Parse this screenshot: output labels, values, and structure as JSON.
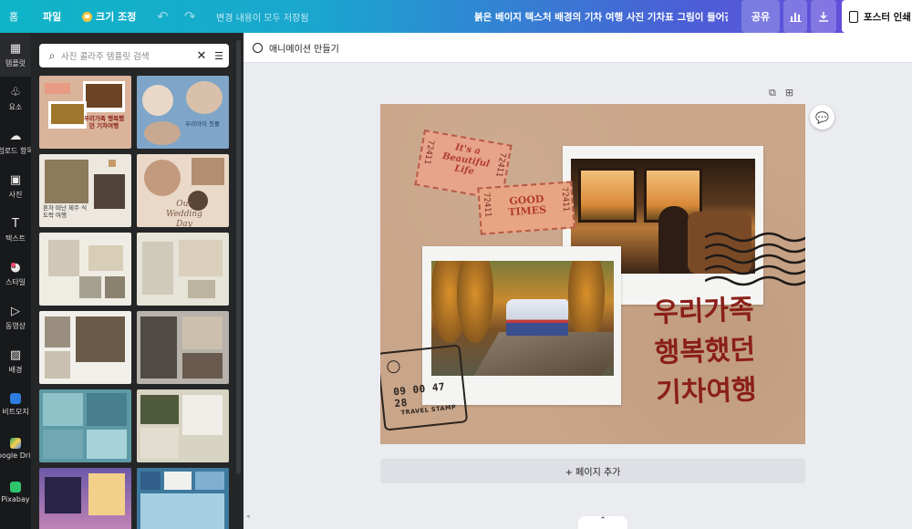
{
  "topbar": {
    "home": "홈",
    "file": "파일",
    "resize": "크기 조정",
    "saved": "변경 내용이 모두 저장됨",
    "title": "붉은 베이지 텍스처 배경의 기차 여행 사진 기차표 그림이 들어간 ...",
    "share": "공유",
    "print": "포스터 인쇄"
  },
  "rail": [
    {
      "label": "템플릿",
      "icon": "template-icon"
    },
    {
      "label": "요소",
      "icon": "elements-icon"
    },
    {
      "label": "업로드 항목",
      "icon": "upload-icon"
    },
    {
      "label": "사진",
      "icon": "photo-icon"
    },
    {
      "label": "텍스트",
      "icon": "text-icon"
    },
    {
      "label": "스타일",
      "icon": "palette-icon"
    },
    {
      "label": "동영상",
      "icon": "video-icon"
    },
    {
      "label": "배경",
      "icon": "background-icon"
    },
    {
      "label": "비트모지",
      "icon": "bitmoji-icon"
    },
    {
      "label": "Google Drive",
      "icon": "google-drive-icon"
    },
    {
      "label": "Pixabay",
      "icon": "pixabay-icon"
    }
  ],
  "search": {
    "placeholder": "사진 콜라주 템플릿 검색"
  },
  "thumbs": [
    {
      "text": "우리가족 행복했던 기차여행",
      "bg": "#d9b39a"
    },
    {
      "text": "우리아이 첫돌",
      "bg": "#7fa6c9"
    },
    {
      "text": "혼자 떠난 제주 식도락 여행",
      "bg": "#ece7df"
    },
    {
      "text": "Our Wedding Day",
      "bg": "#ead8c9"
    },
    {
      "text": "",
      "bg": "#efece4"
    },
    {
      "text": "",
      "bg": "#e6e3d8"
    },
    {
      "text": "",
      "bg": "#f1efea"
    },
    {
      "text": "",
      "bg": "#b7b2ab"
    },
    {
      "text": "",
      "bg": "#5d9aa6"
    },
    {
      "text": "",
      "bg": "#d7d4c2"
    },
    {
      "text": "",
      "bg": "#6c5aa8"
    },
    {
      "text": "",
      "bg": "#3f7a9e"
    }
  ],
  "canvas": {
    "animate": "애니메이션 만들기",
    "ticket1_text": "It's a Beautiful Life",
    "ticket1_num": "72411",
    "ticket2_text": "GOOD TIMES",
    "ticket2_num": "72411",
    "stamp_number": "09 00 47 28",
    "stamp_label": "TRAVEL STAMP",
    "headline": [
      "우리가족",
      "행복했던",
      "기차여행"
    ],
    "add_page": "+ 페이지 추가"
  }
}
